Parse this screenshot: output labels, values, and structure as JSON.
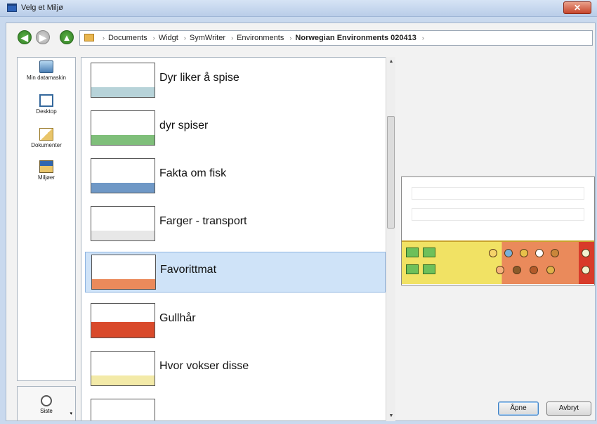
{
  "window": {
    "title": "Velg et Miljø",
    "close_label": "✕"
  },
  "nav": {
    "back_icon": "◀",
    "forward_icon": "▶",
    "up_icon": "▲",
    "breadcrumbs": [
      "Documents",
      "Widgt",
      "SymWriter",
      "Environments",
      "Norwegian Environments 020413"
    ],
    "trailing_sep": "›"
  },
  "places": {
    "items": [
      {
        "label": "Min datamaskin",
        "icon": "computer-icon"
      },
      {
        "label": "Desktop",
        "icon": "desktop-icon"
      },
      {
        "label": "Dokumenter",
        "icon": "documents-folder-icon"
      },
      {
        "label": "Miljøer",
        "icon": "environments-folder-icon"
      }
    ],
    "recent": {
      "label": "Siste",
      "icon": "clock-icon",
      "arrow": "▾"
    }
  },
  "files": {
    "items": [
      {
        "label": "Dyr liker å spise",
        "strip": "#b7d3d9"
      },
      {
        "label": "dyr spiser",
        "strip": "#7fbf7a"
      },
      {
        "label": "Fakta om fisk",
        "strip": "#6f98c6"
      },
      {
        "label": "Farger - transport",
        "strip": "#e7e7e7"
      },
      {
        "label": "Favorittmat",
        "strip": "#ea8a5b",
        "selected": true
      },
      {
        "label": "Gullhår",
        "strip": "#d94a2b"
      },
      {
        "label": "Hvor vokser disse",
        "strip": "#f3eaa8"
      }
    ]
  },
  "scroll": {
    "up_icon": "▲",
    "down_icon": "▼"
  },
  "buttons": {
    "open": "Åpne",
    "cancel": "Avbryt"
  }
}
